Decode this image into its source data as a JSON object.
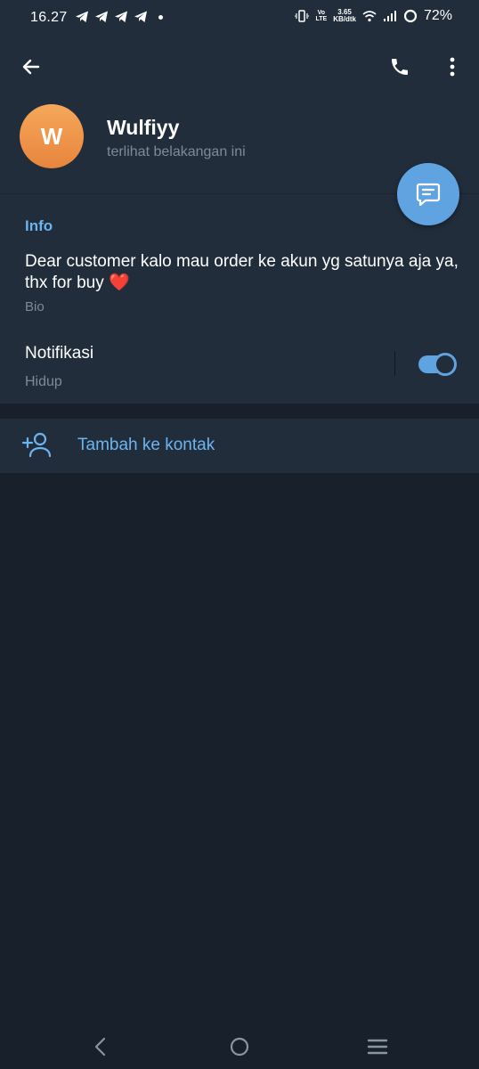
{
  "status_bar": {
    "time": "16.27",
    "volte": "Vo\nLTE",
    "net_speed_value": "3.65",
    "net_speed_unit": "KB/dtk",
    "battery": "72%"
  },
  "header": {
    "avatar_initial": "W",
    "name": "Wulfiyy",
    "last_seen": "terlihat belakangan ini"
  },
  "info": {
    "title": "Info",
    "bio": "Dear customer kalo mau order ke akun yg satunya aja ya, thx for buy",
    "bio_emoji": "❤️",
    "bio_label": "Bio",
    "notifications_label": "Notifikasi",
    "notifications_status": "Hidup",
    "notifications_on": true
  },
  "actions": {
    "add_contact": "Tambah ke kontak"
  },
  "colors": {
    "header_bg": "#212d3b",
    "page_bg": "#18202b",
    "accent": "#5fa3e0",
    "link": "#6cb4f0",
    "muted": "#7d8b99",
    "avatar": "#f0974b"
  },
  "icons": {
    "back": "arrow-left-icon",
    "call": "phone-icon",
    "more": "more-vertical-icon",
    "message": "message-icon",
    "add_contact": "add-user-icon"
  }
}
